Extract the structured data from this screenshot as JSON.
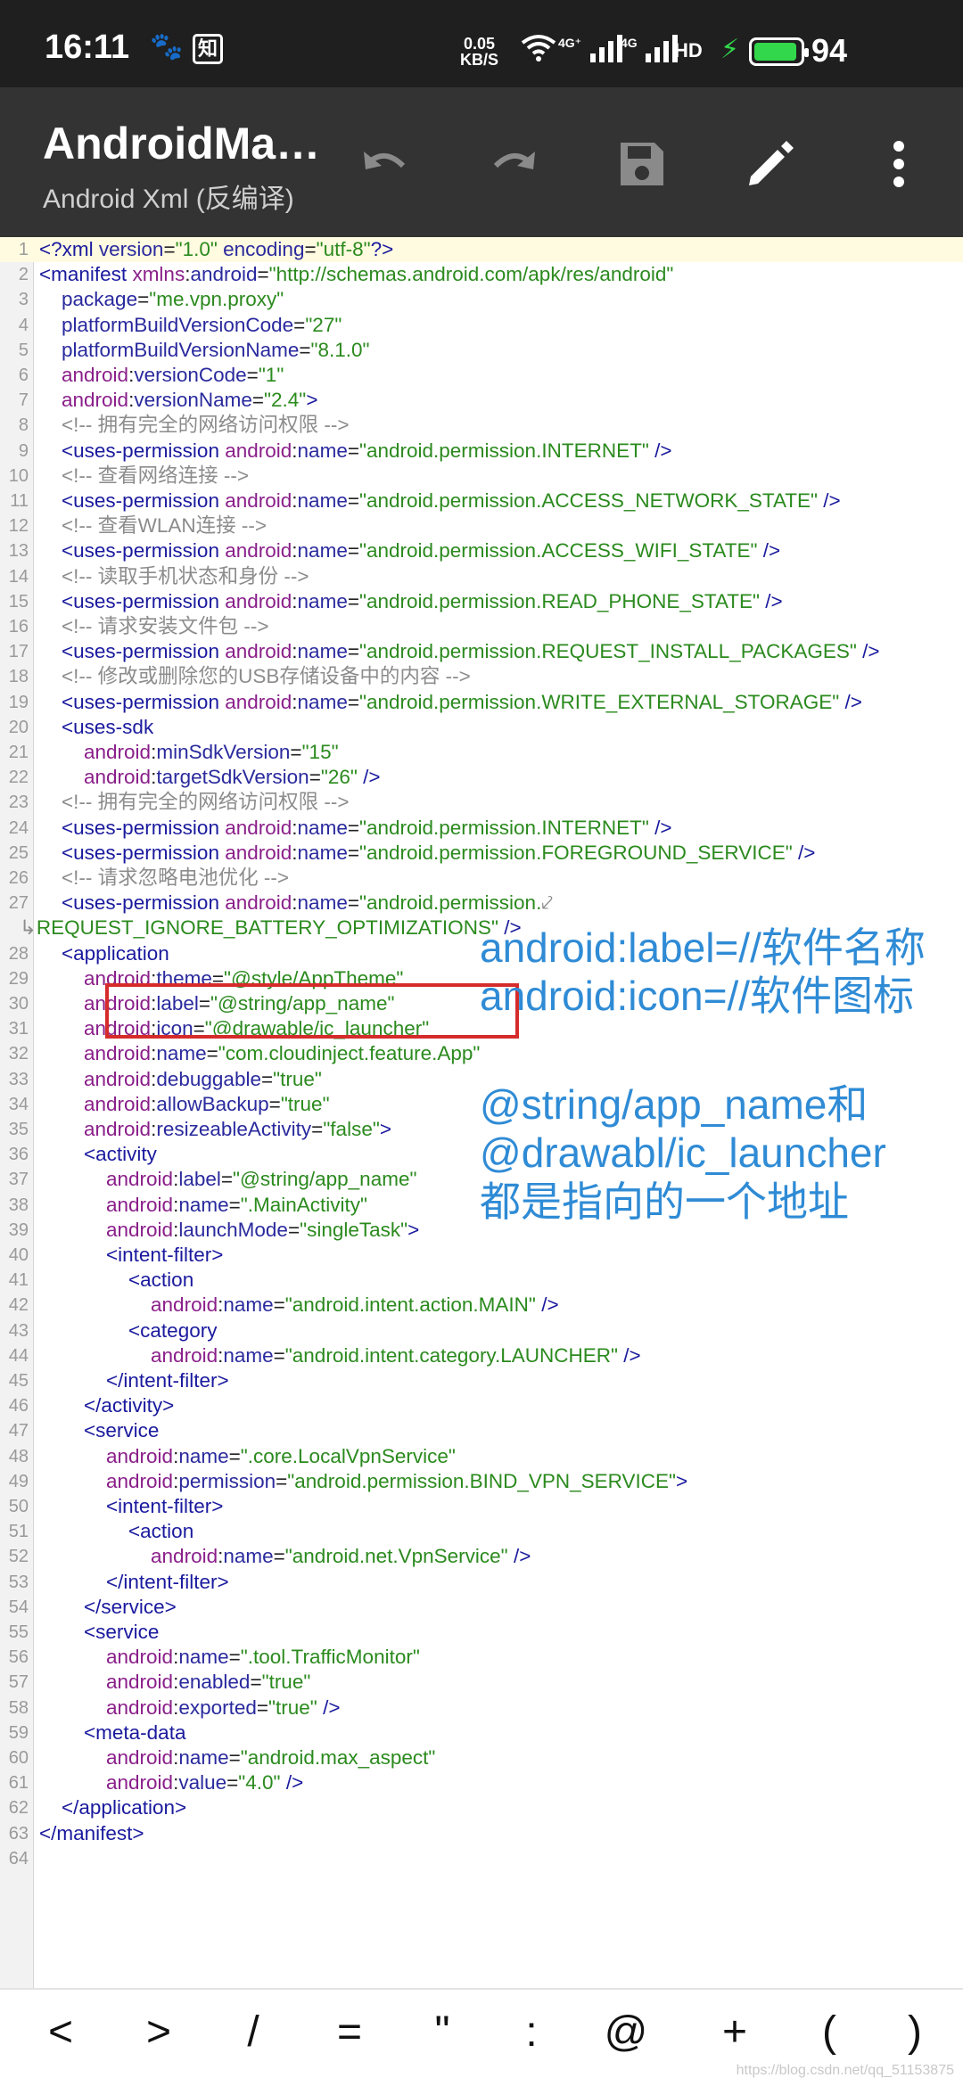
{
  "status_bar": {
    "time": "16:11",
    "notif_icons": [
      "paw-icon",
      "zhihu-icon"
    ],
    "zhi_label": "知",
    "net_speed_value": "0.05",
    "net_speed_unit": "KB/S",
    "signal1_label": "4G⁺",
    "signal2_label": "4G",
    "hd_label": "HD",
    "battery_level": "94",
    "battery_fraction": 0.94,
    "battery_color": "#32d74b"
  },
  "toolbar": {
    "title": "AndroidMa…",
    "subtitle": "Android Xml (反编译)",
    "icons": [
      "undo-icon",
      "redo-icon",
      "save-icon",
      "edit-icon",
      "more-vert-icon"
    ]
  },
  "editor": {
    "line_numbers": [
      "1",
      "2",
      "3",
      "4",
      "5",
      "6",
      "7",
      "8",
      "9",
      "10",
      "11",
      "12",
      "13",
      "14",
      "15",
      "16",
      "17",
      "18",
      "19",
      "20",
      "21",
      "22",
      "23",
      "24",
      "25",
      "26",
      "27",
      "",
      "28",
      "29",
      "30",
      "31",
      "32",
      "33",
      "34",
      "35",
      "36",
      "37",
      "38",
      "39",
      "40",
      "41",
      "42",
      "43",
      "44",
      "45",
      "46",
      "47",
      "48",
      "49",
      "50",
      "51",
      "52",
      "53",
      "54",
      "55",
      "56",
      "57",
      "58",
      "59",
      "60",
      "61",
      "62",
      "63",
      "64"
    ]
  },
  "annotations": {
    "right_note_1": "android:label=//软件名称\nandroid:icon=//软件图标",
    "right_note_2": "@string/app_name和\n@drawabl/ic_launcher\n都是指向的一个地址"
  },
  "symbol_bar": {
    "symbols": [
      "<",
      ">",
      "/",
      "=",
      "\"",
      ":",
      "@",
      "+",
      "(",
      ")"
    ]
  },
  "watermark": "https://blog.csdn.net/qq_51153875",
  "colors": {
    "toolbar_bg": "#333333",
    "highlight_box": "#d62b2b",
    "annotation_text": "#2f8bd5"
  }
}
